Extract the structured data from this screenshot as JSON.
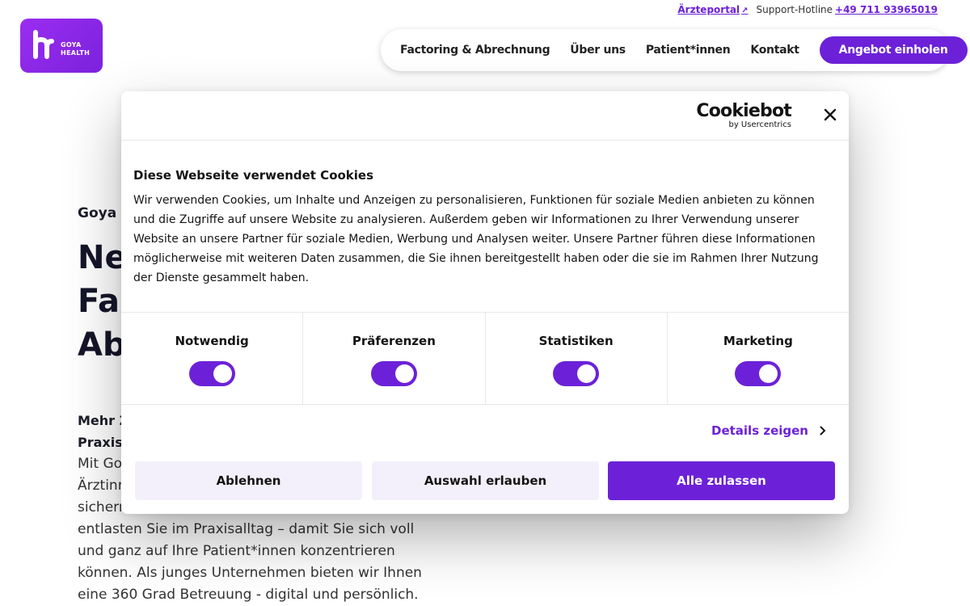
{
  "util": {
    "portal_label": "Ärzteportal",
    "portal_arrow": "↗",
    "hotline_label": "Support-Hotline",
    "hotline_number": "+49 711 93965019"
  },
  "logo": {
    "line1": "GOYA",
    "line2": "HEALTH"
  },
  "nav": {
    "items": [
      "Factoring & Abrechnung",
      "Über uns",
      "Patient*innen",
      "Kontakt"
    ],
    "cta": "Angebot einholen"
  },
  "hero": {
    "kicker": "Goya H",
    "title_lines": [
      "Ne",
      "Fa",
      "Ab"
    ],
    "lead_lines": [
      "Mehr Z",
      "Praxis"
    ],
    "body_lines": [
      "Mit Go",
      "Ärztinn",
      "sichern",
      "entlasten Sie im Praxisalltag – damit Sie sich voll",
      "und ganz auf Ihre Patient*innen konzentrieren",
      "können. Als junges Unternehmen bieten wir Ihnen",
      "eine 360 Grad Betreuung - digital und persönlich."
    ]
  },
  "cookie": {
    "brand": "Cookiebot",
    "brand_sub": "by Usercentrics",
    "title": "Diese Webseite verwendet Cookies",
    "text_lines": [
      "Wir verwenden Cookies, um Inhalte und Anzeigen zu personalisieren, Funktionen für soziale Medien anbieten zu können",
      "und die Zugriffe auf unsere Website zu analysieren. Außerdem geben wir Informationen zu Ihrer Verwendung unserer",
      "Website an unsere Partner für soziale Medien, Werbung und Analysen weiter. Unsere Partner führen diese Informationen",
      "möglicherweise mit weiteren Daten zusammen, die Sie ihnen bereitgestellt haben oder die sie im Rahmen Ihrer Nutzung",
      "der Dienste gesammelt haben."
    ],
    "categories": [
      {
        "label": "Notwendig",
        "enabled": true
      },
      {
        "label": "Präferenzen",
        "enabled": true
      },
      {
        "label": "Statistiken",
        "enabled": true
      },
      {
        "label": "Marketing",
        "enabled": true
      }
    ],
    "details_label": "Details zeigen",
    "buttons": {
      "reject": "Ablehnen",
      "allow_selection": "Auswahl erlauben",
      "allow_all": "Alle zulassen"
    }
  },
  "colors": {
    "accent": "#6c21d8",
    "logo_bg": "#8a27e6",
    "button_light": "#f4f0fb"
  }
}
